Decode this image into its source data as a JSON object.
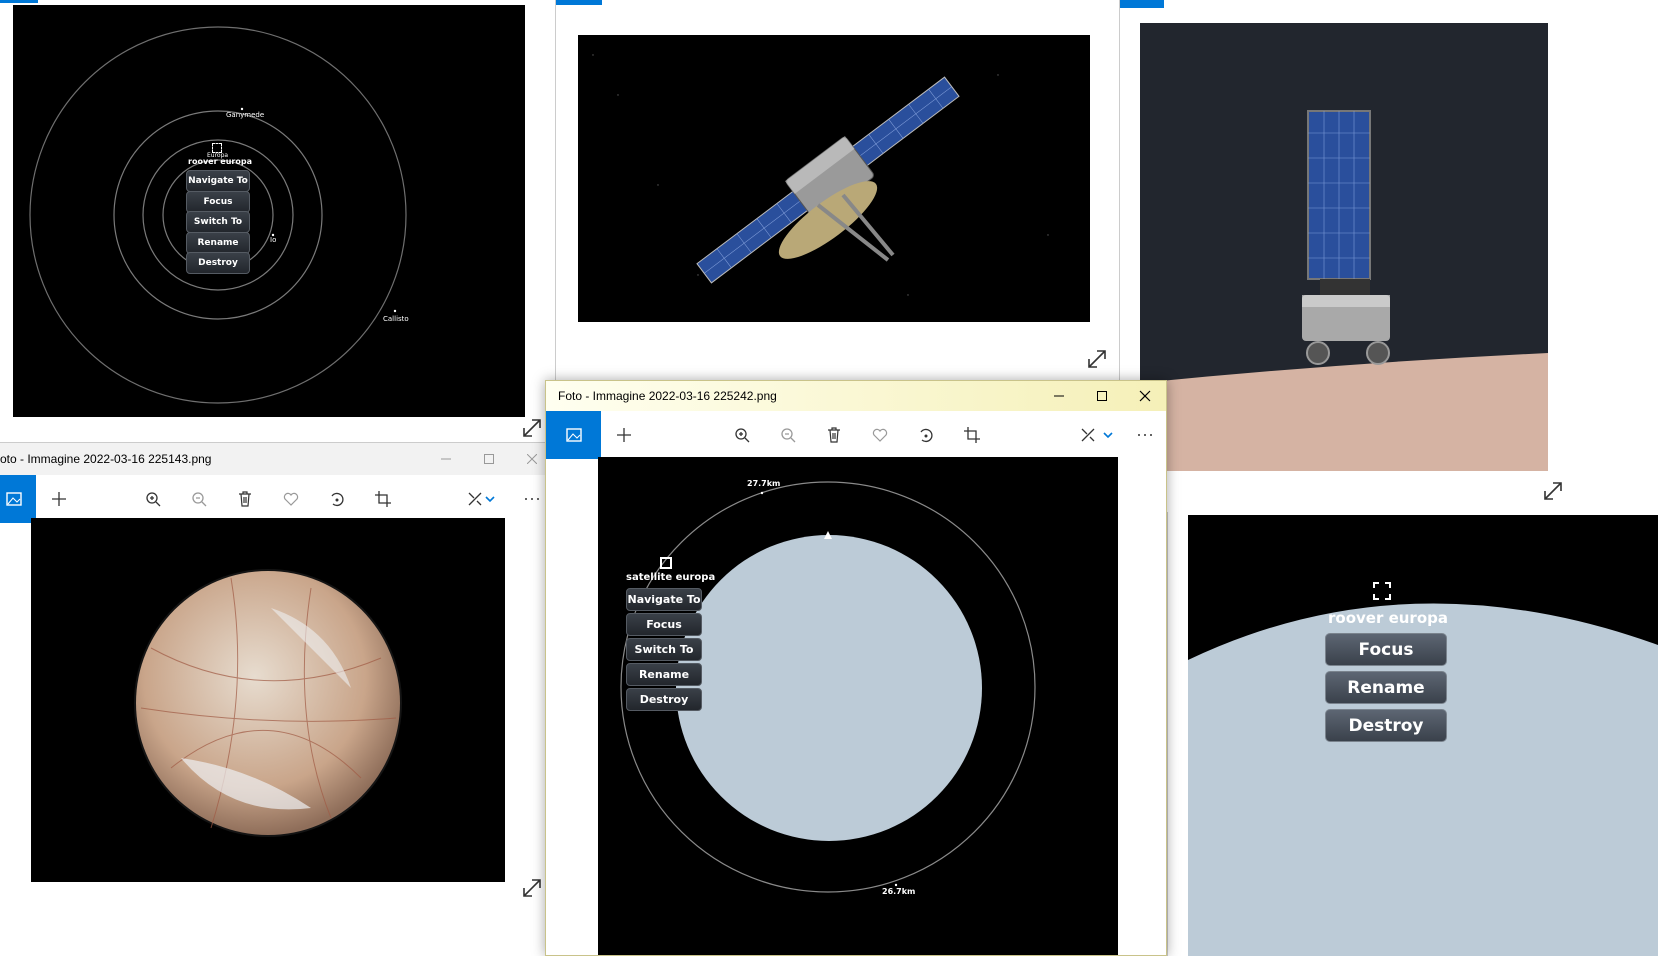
{
  "window_back_left": {
    "menu_title": "roover europa",
    "menu_items": [
      "Navigate To",
      "Focus",
      "Switch To",
      "Rename",
      "Destroy"
    ],
    "labels": {
      "ganymede": "Ganymede",
      "europa": "Europa",
      "io": "Io",
      "callisto": "Callisto"
    }
  },
  "window_mid_left": {
    "title": "oto - Immagine 2022-03-16 225143.png"
  },
  "window_front": {
    "title": "Foto - Immagine 2022-03-16 225242.png",
    "menu_title": "satellite europa",
    "menu_items": [
      "Navigate To",
      "Focus",
      "Switch To",
      "Rename",
      "Destroy"
    ],
    "altitude_top": "27.7km",
    "altitude_bottom": "26.7km"
  },
  "window_right_bottom": {
    "menu_title": "roover europa",
    "menu_items": [
      "Focus",
      "Rename",
      "Destroy"
    ]
  },
  "toolbar_icons": [
    "photo-icon",
    "add-icon",
    "zoom-in-icon",
    "zoom-out-icon",
    "delete-icon",
    "favorite-icon",
    "rotate-icon",
    "crop-icon",
    "edit-icon",
    "more-icon"
  ],
  "colors": {
    "accent": "#0078d7",
    "space": "#000000",
    "planet_pale": "#bccbd7"
  }
}
